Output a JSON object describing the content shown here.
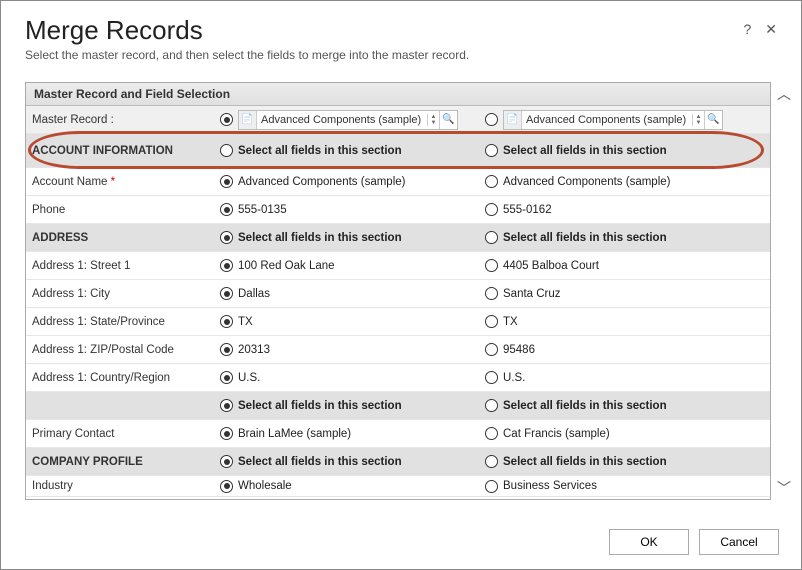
{
  "header": {
    "title": "Merge Records",
    "subtitle": "Select the master record, and then select the fields to merge into the master record."
  },
  "grid_title": "Master Record and Field Selection",
  "master_record_label": "Master Record :",
  "master_options": {
    "a": "Advanced Components (sample)",
    "b": "Advanced Components (sample)"
  },
  "sections": {
    "account_info": {
      "label": "ACCOUNT INFORMATION",
      "select_all": "Select all fields in this section"
    },
    "address": {
      "label": "ADDRESS",
      "select_all": "Select all fields in this section"
    },
    "blank": {
      "select_all": "Select all fields in this section"
    },
    "company": {
      "label": "COMPANY PROFILE",
      "select_all": "Select all fields in this section"
    }
  },
  "fields": {
    "account_name": {
      "label": "Account Name",
      "a": "Advanced Components (sample)",
      "b": "Advanced Components (sample)"
    },
    "phone": {
      "label": "Phone",
      "a": "555-0135",
      "b": "555-0162"
    },
    "street": {
      "label": "Address 1: Street 1",
      "a": "100 Red Oak Lane",
      "b": "4405 Balboa Court"
    },
    "city": {
      "label": "Address 1: City",
      "a": "Dallas",
      "b": "Santa Cruz"
    },
    "state": {
      "label": "Address 1: State/Province",
      "a": "TX",
      "b": "TX"
    },
    "zip": {
      "label": "Address 1: ZIP/Postal Code",
      "a": "20313",
      "b": "95486"
    },
    "country": {
      "label": "Address 1: Country/Region",
      "a": "U.S.",
      "b": "U.S."
    },
    "primary": {
      "label": "Primary Contact",
      "a": "Brain LaMee (sample)",
      "b": "Cat Francis (sample)"
    },
    "industry": {
      "label": "Industry",
      "a": "Wholesale",
      "b": "Business Services"
    }
  },
  "buttons": {
    "ok": "OK",
    "cancel": "Cancel"
  },
  "icons": {
    "help": "?",
    "close": "✕",
    "doc": "📄",
    "lookup": "🔍",
    "up": "︿",
    "down": "﹀"
  }
}
